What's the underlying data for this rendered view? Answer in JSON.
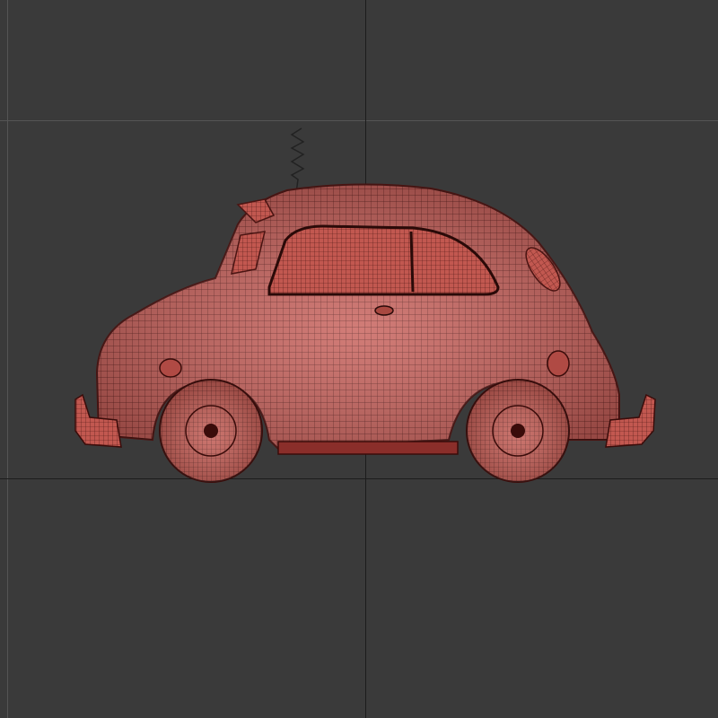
{
  "viewport": {
    "background_color": "#3a3a3a",
    "grid_line_color": "#555555",
    "axis_line_color": "#1c1c1c",
    "model_color": "#c8605a",
    "wire_color": "#5a1a18",
    "model_name_icon": "car-wireframe-model"
  }
}
